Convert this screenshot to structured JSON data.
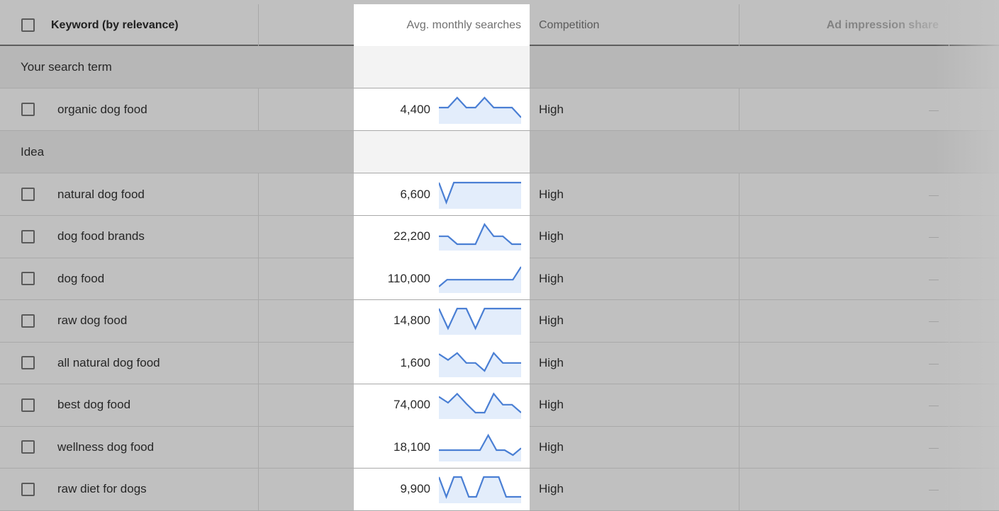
{
  "header": {
    "keyword_label": "Keyword (by relevance)",
    "avg_label": "Avg. monthly searches",
    "competition_label": "Competition",
    "impression_label": "Ad impression share"
  },
  "groups": {
    "search_term": "Your search term",
    "idea": "Idea"
  },
  "colors": {
    "spark_line": "#4a7fd4",
    "spark_fill": "#e3edfb",
    "highlight_column": "#ffffff"
  },
  "search_term_row": {
    "keyword": "organic dog food",
    "avg": "4,400",
    "competition": "High",
    "impression": "—",
    "trend": [
      0.5,
      0.5,
      1,
      0.5,
      0.5,
      1,
      0.5,
      0.5,
      0.5,
      0
    ]
  },
  "idea_rows": [
    {
      "keyword": "natural dog food",
      "avg": "6,600",
      "competition": "High",
      "impression": "—",
      "trend": [
        1,
        0,
        1,
        1,
        1,
        1,
        1,
        1,
        1,
        1,
        1,
        1
      ]
    },
    {
      "keyword": "dog food brands",
      "avg": "22,200",
      "competition": "High",
      "impression": "—",
      "trend": [
        0.4,
        0.4,
        0,
        0,
        0,
        1,
        0.4,
        0.4,
        0,
        0
      ]
    },
    {
      "keyword": "dog food",
      "avg": "110,000",
      "competition": "High",
      "impression": "—",
      "trend": [
        0,
        0.35,
        0.35,
        0.35,
        0.35,
        0.35,
        0.35,
        0.35,
        0.35,
        0.35,
        1
      ]
    },
    {
      "keyword": "raw dog food",
      "avg": "14,800",
      "competition": "High",
      "impression": "—",
      "trend": [
        1,
        0,
        1,
        1,
        0,
        1,
        1,
        1,
        1,
        1
      ]
    },
    {
      "keyword": "all natural dog food",
      "avg": "1,600",
      "competition": "High",
      "impression": "—",
      "trend": [
        0.85,
        0.55,
        0.9,
        0.4,
        0.4,
        0,
        0.9,
        0.4,
        0.4,
        0.4
      ]
    },
    {
      "keyword": "best dog food",
      "avg": "74,000",
      "competition": "High",
      "impression": "—",
      "trend": [
        0.8,
        0.5,
        0.95,
        0.45,
        0,
        0,
        0.95,
        0.4,
        0.4,
        0
      ]
    },
    {
      "keyword": "wellness dog food",
      "avg": "18,100",
      "competition": "High",
      "impression": "—",
      "trend": [
        0.25,
        0.25,
        0.25,
        0.25,
        0.25,
        0.25,
        1,
        0.25,
        0.25,
        0,
        0.35
      ]
    },
    {
      "keyword": "raw diet for dogs",
      "avg": "9,900",
      "competition": "High",
      "impression": "—",
      "trend": [
        1,
        0,
        1,
        1,
        0,
        0,
        1,
        1,
        1,
        0,
        0,
        0
      ]
    }
  ]
}
